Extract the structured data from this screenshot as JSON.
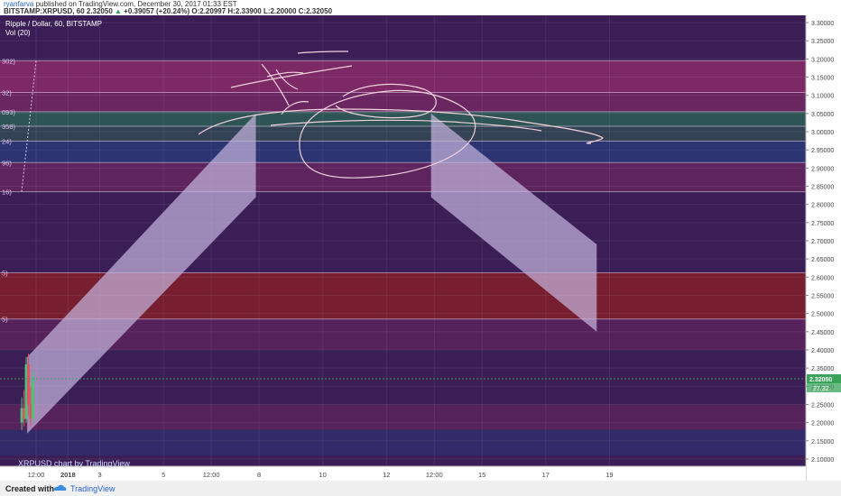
{
  "header": {
    "author": "ryanfarva",
    "published_text": "published on TradingView.com, December 30, 2017 01:33 EST",
    "symbol_line": "BITSTAMP:XRPUSD, 60  2.32050",
    "change": "+0.39057 (+20.24%)",
    "ohlc": "O:2.20997  H:2.33900  L:2.20000  C:2.32050"
  },
  "legend": {
    "pair": "Ripple / Dollar, 60, BITSTAMP",
    "volume": "Vol (20)"
  },
  "watermark": "XRPUSD chart by TradingView",
  "footer": {
    "created_with": "Created with",
    "brand": "TradingView"
  },
  "colors": {
    "background": "#3b1e56",
    "fib_band_pink": "#8a2c68",
    "fib_band_blue": "#2c3676",
    "fib_band_green": "#2e5a55",
    "fib_band_red": "#7a1f2e",
    "projection": "#c3b3dc",
    "drawing": "#f0d2dc",
    "last_price": "#3aa35a"
  },
  "chart_data": {
    "type": "candlestick",
    "title": "Ripple / Dollar, 60, BITSTAMP",
    "ylim": [
      2.08,
      3.32
    ],
    "y_ticks": [
      "3.30000",
      "3.25000",
      "3.20000",
      "3.15000",
      "3.10000",
      "3.05000",
      "3.00000",
      "2.95000",
      "2.90000",
      "2.85000",
      "2.80000",
      "2.75000",
      "2.70000",
      "2.65000",
      "2.60000",
      "2.55000",
      "2.50000",
      "2.45000",
      "2.40000",
      "2.35000",
      "2.30000",
      "2.25000",
      "2.20000",
      "2.15000",
      "2.10000"
    ],
    "x_ticks": [
      {
        "label": "12:00",
        "pos": 0.0
      },
      {
        "label": "2018",
        "pos": 1.0
      },
      {
        "label": "3",
        "pos": 2.0
      },
      {
        "label": "5",
        "pos": 4.0
      },
      {
        "label": "12:00",
        "pos": 5.5
      },
      {
        "label": "8",
        "pos": 7.0
      },
      {
        "label": "10",
        "pos": 9.0
      },
      {
        "label": "12",
        "pos": 11.0
      },
      {
        "label": "12:00",
        "pos": 12.5
      },
      {
        "label": "15",
        "pos": 14.0
      },
      {
        "label": "17",
        "pos": 16.0
      },
      {
        "label": "19",
        "pos": 18.0
      }
    ],
    "fib_levels": [
      {
        "label": "302)",
        "price": 3.195
      },
      {
        "label": "32)",
        "price": 3.108
      },
      {
        "label": "093)",
        "price": 3.055
      },
      {
        "label": "358)",
        "price": 3.015
      },
      {
        "label": "24)",
        "price": 2.974
      },
      {
        "label": "96)",
        "price": 2.915
      },
      {
        "label": "16)",
        "price": 2.835
      },
      {
        "label": "5)",
        "price": 2.612
      },
      {
        "label": "5)",
        "price": 2.485
      }
    ],
    "bands": [
      {
        "from": 3.195,
        "to": 3.108,
        "color": "fib_band_pink",
        "opacity": 0.85
      },
      {
        "from": 3.108,
        "to": 3.055,
        "color": "fib_band_pink",
        "opacity": 0.6
      },
      {
        "from": 3.055,
        "to": 3.015,
        "color": "fib_band_green",
        "opacity": 0.9
      },
      {
        "from": 3.015,
        "to": 2.974,
        "color": "fib_band_green",
        "opacity": 0.6
      },
      {
        "from": 2.974,
        "to": 2.915,
        "color": "fib_band_blue",
        "opacity": 0.9
      },
      {
        "from": 2.915,
        "to": 2.835,
        "color": "fib_band_pink",
        "opacity": 0.45
      },
      {
        "from": 2.612,
        "to": 2.485,
        "color": "fib_band_red",
        "opacity": 0.95
      },
      {
        "from": 2.485,
        "to": 2.4,
        "color": "fib_band_pink",
        "opacity": 0.35
      },
      {
        "from": 2.25,
        "to": 2.18,
        "color": "fib_band_pink",
        "opacity": 0.35
      },
      {
        "from": 2.18,
        "to": 2.11,
        "color": "fib_band_blue",
        "opacity": 0.6
      }
    ],
    "candles": [
      {
        "t": -0.45,
        "o": 2.2,
        "h": 2.27,
        "l": 2.18,
        "c": 2.24
      },
      {
        "t": -0.38,
        "o": 2.24,
        "h": 2.29,
        "l": 2.19,
        "c": 2.21
      },
      {
        "t": -0.31,
        "o": 2.21,
        "h": 2.38,
        "l": 2.2,
        "c": 2.36
      },
      {
        "t": -0.24,
        "o": 2.36,
        "h": 2.39,
        "l": 2.22,
        "c": 2.25
      },
      {
        "t": -0.17,
        "o": 2.25,
        "h": 2.3,
        "l": 2.19,
        "c": 2.21
      },
      {
        "t": -0.1,
        "o": 2.21,
        "h": 2.34,
        "l": 2.2,
        "c": 2.32
      }
    ],
    "projections": [
      {
        "points": [
          [
            -0.28,
            2.38
          ],
          [
            6.9,
            3.05
          ],
          [
            6.9,
            2.82
          ],
          [
            -0.28,
            2.17
          ]
        ]
      },
      {
        "points": [
          [
            12.4,
            3.05
          ],
          [
            17.6,
            2.69
          ],
          [
            17.6,
            2.45
          ],
          [
            12.4,
            2.82
          ]
        ]
      }
    ],
    "last_price": {
      "value": 2.3205,
      "label": "2.32050",
      "vol_label": "27.32"
    }
  }
}
